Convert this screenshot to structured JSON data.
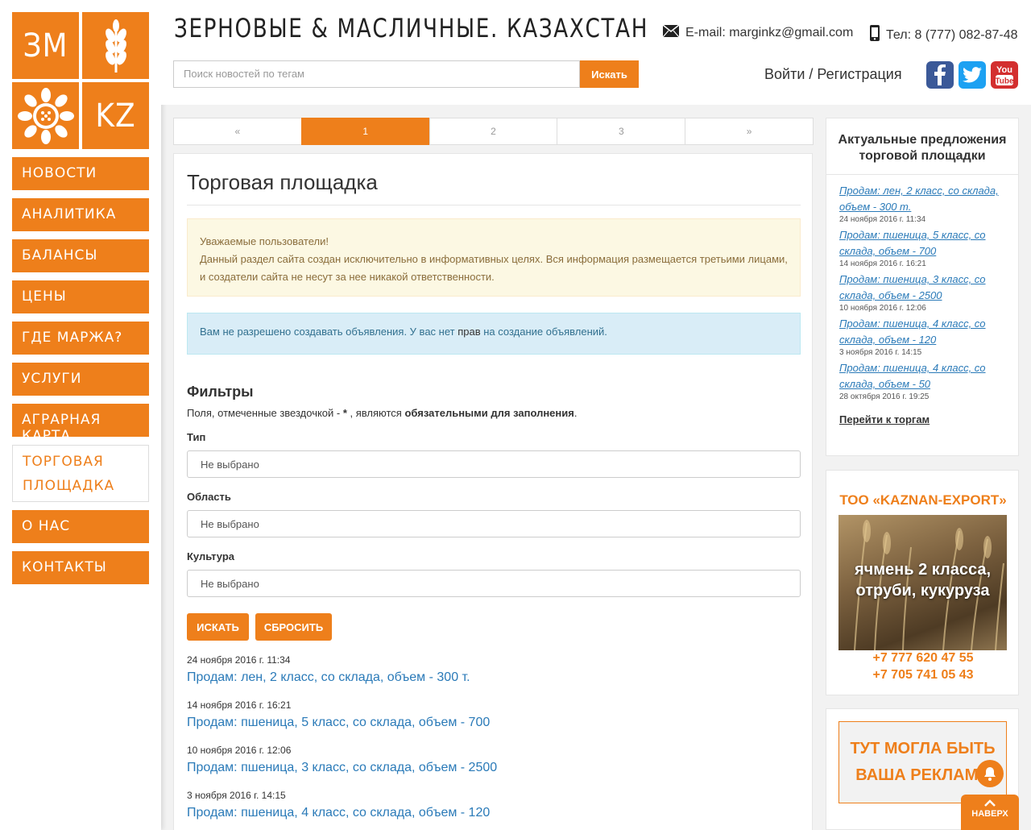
{
  "logo": {
    "cells": [
      "ЗМ",
      "",
      "",
      "KZ"
    ]
  },
  "nav": [
    {
      "label": "НОВОСТИ"
    },
    {
      "label": "АНАЛИТИКА"
    },
    {
      "label": "БАЛАНСЫ"
    },
    {
      "label": "ЦЕНЫ"
    },
    {
      "label": "ГДЕ МАРЖА?"
    },
    {
      "label": "УСЛУГИ"
    },
    {
      "label": "АГРАРНАЯ КАРТА"
    },
    {
      "label": "ТОРГОВАЯ ПЛОЩАДКА",
      "active": true
    },
    {
      "label": "О НАС"
    },
    {
      "label": "КОНТАКТЫ"
    }
  ],
  "header": {
    "title": "ЗЕРНОВЫЕ & МАСЛИЧНЫЕ. КАЗАХСТАН",
    "email": "E-mail: marginkz@gmail.com",
    "phone": "Тел: 8 (777) 082-87-48",
    "search_placeholder": "Поиск новостей по тегам",
    "search_button": "Искать",
    "login": "Войти / Регистрация"
  },
  "pager": [
    "«",
    "1",
    "2",
    "3",
    "»"
  ],
  "main": {
    "title": "Торговая площадка",
    "warn_line1": "Уважаемые пользователи!",
    "warn_line2": "Данный раздел сайта создан исключительно в информативных целях. Вся информация размещается третьими лицами, и создатели сайта не несут за нее никакой ответственности.",
    "info_pre": "Вам не разрешено создавать объявления. У вас нет ",
    "info_bold": "прав",
    "info_post": " на создание объявлений.",
    "filters_title": "Фильтры",
    "req_pre": "Поля, отмеченные звездочкой - ",
    "req_star": "*",
    "req_mid": " , являются ",
    "req_bold": "обязательными для заполнения",
    "req_end": ".",
    "fields": [
      {
        "label": "Тип",
        "value": "Не выбрано"
      },
      {
        "label": "Область",
        "value": "Не выбрано"
      },
      {
        "label": "Культура",
        "value": "Не выбрано"
      }
    ],
    "btn_search": "ИСКАТЬ",
    "btn_reset": "СБРОСИТЬ",
    "listings": [
      {
        "date": "24 ноября 2016 г. 11:34",
        "title": "Продам: лен, 2 класс, со склада, объем - 300 т."
      },
      {
        "date": "14 ноября 2016 г. 16:21",
        "title": "Продам: пшеница, 5 класс, со склада, объем - 700"
      },
      {
        "date": "10 ноября 2016 г. 12:06",
        "title": "Продам: пшеница, 3 класс, со склада, объем - 2500"
      },
      {
        "date": "3 ноября 2016 г. 14:15",
        "title": "Продам: пшеница, 4 класс, со склада, объем - 120"
      }
    ]
  },
  "aside": {
    "title": "Актуальные предложения торговой площадки",
    "offers": [
      {
        "title": "Продам: лен, 2 класс, со склада, объем - 300 т.",
        "date": "24 ноября 2016 г. 11:34"
      },
      {
        "title": "Продам: пшеница, 5 класс, со склада, объем - 700",
        "date": "14 ноября 2016 г. 16:21"
      },
      {
        "title": "Продам: пшеница, 3 класс, со склада, объем - 2500",
        "date": "10 ноября 2016 г. 12:06"
      },
      {
        "title": "Продам: пшеница, 4 класс, со склада, объем - 120",
        "date": "3 ноября 2016 г. 14:15"
      },
      {
        "title": "Продам: пшеница, 4 класс, со склада, объем - 50",
        "date": "28 октября 2016 г. 19:25"
      }
    ],
    "goto": "Перейти к торгам"
  },
  "ad": {
    "company": "ТОО «KAZNAN-EXPORT»",
    "products": "ячмень 2 класса, отруби, кукуруза",
    "phone1": "+7 777 620 47 55",
    "phone2": "+7 705 741 05 43"
  },
  "ad_slot": "ТУТ МОГЛА БЫТЬ ВАША РЕКЛАМА",
  "totop": "НАВЕРХ",
  "colors": {
    "accent": "#ee7f1b",
    "link": "#2a7ab8"
  }
}
